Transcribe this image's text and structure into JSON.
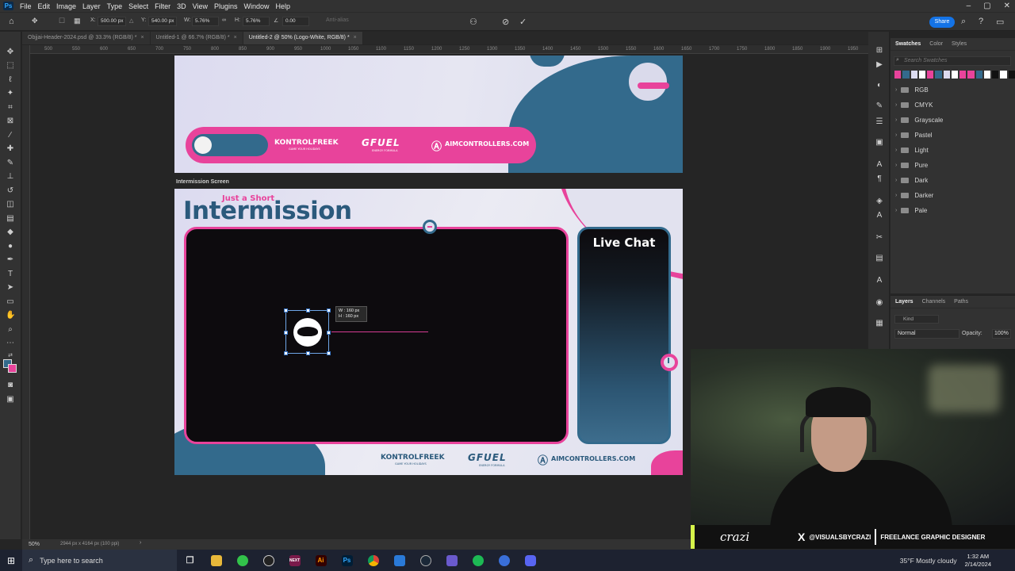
{
  "menubar": {
    "app_logo": "Ps",
    "items": [
      "File",
      "Edit",
      "Image",
      "Layer",
      "Type",
      "Select",
      "Filter",
      "3D",
      "View",
      "Plugins",
      "Window",
      "Help"
    ]
  },
  "options": {
    "x_label": "X:",
    "x_value": "500.00 px",
    "y_label": "Y:",
    "y_value": "540.00 px",
    "w_label": "W:",
    "w_value": "5.76%",
    "h_label": "H:",
    "h_value": "5.76%",
    "angle_value": "0.00",
    "antialias_label": "Anti-alias",
    "share_label": "Share"
  },
  "tabs": [
    "Objjai-Header-2024.psd @ 33.3% (RGB/8) *",
    "Untitled-1 @ 66.7% (RGB/8) *",
    "Untitled-2 @ 50% (Logo-White, RGB/8) *"
  ],
  "ruler": {
    "ticks": [
      "500",
      "550",
      "600",
      "650",
      "700",
      "750",
      "800",
      "850",
      "900",
      "950",
      "1000",
      "1050",
      "1100",
      "1150",
      "1200",
      "1250",
      "1300",
      "1350",
      "1400",
      "1450",
      "1500",
      "1550",
      "1600",
      "1650",
      "1700",
      "1750",
      "1800",
      "1850",
      "1900",
      "1950",
      "2000"
    ]
  },
  "swatches": {
    "tabs": [
      "Swatches",
      "Color",
      "Styles"
    ],
    "search_placeholder": "Search Swatches",
    "colors": [
      "#e8439b",
      "#336a8c",
      "#dcdbf0",
      "#ffffff",
      "#e8439b",
      "#336a8c",
      "#dcdbf0",
      "#ffffff",
      "#e8439b",
      "#e8439b",
      "#336a8c",
      "#ffffff",
      "#111111",
      "#ffffff",
      "#111111"
    ],
    "folders": [
      "RGB",
      "CMYK",
      "Grayscale",
      "Pastel",
      "Light",
      "Pure",
      "Dark",
      "Darker",
      "Pale"
    ]
  },
  "layers": {
    "tabs": [
      "Layers",
      "Channels",
      "Paths"
    ],
    "kind_label": "Kind",
    "blend_mode": "Normal",
    "opacity_label": "Opacity:",
    "opacity_value": "100%"
  },
  "header_artboard": {
    "sponsor1": "KONTROLFREEK",
    "sponsor1_tagline": "GAME YOUR HOLIDAYS",
    "sponsor2": "GFUEL",
    "sponsor2_tagline": "ENERGY FORMULA",
    "sponsor3": "AIMCONTROLLERS.COM"
  },
  "intermission": {
    "artboard_label": "Intermission Screen",
    "subtitle": "Just a Short",
    "title": "Intermission",
    "chat_title": "Live Chat",
    "size_w": "W :  160 px",
    "size_h": "H :  160 px"
  },
  "webcam": {
    "signature": "crazi",
    "handle": "@VISUALSBYCRAZI",
    "role": "FREELANCE GRAPHIC DESIGNER"
  },
  "statusbar": {
    "zoom": "50%",
    "doc_info": "2944 px x 4164 px (100 ppi)"
  },
  "taskbar": {
    "search_placeholder": "Type here to search",
    "weather": "35°F  Mostly cloudy",
    "time": "1:32 AM",
    "date": "2/14/2024"
  }
}
